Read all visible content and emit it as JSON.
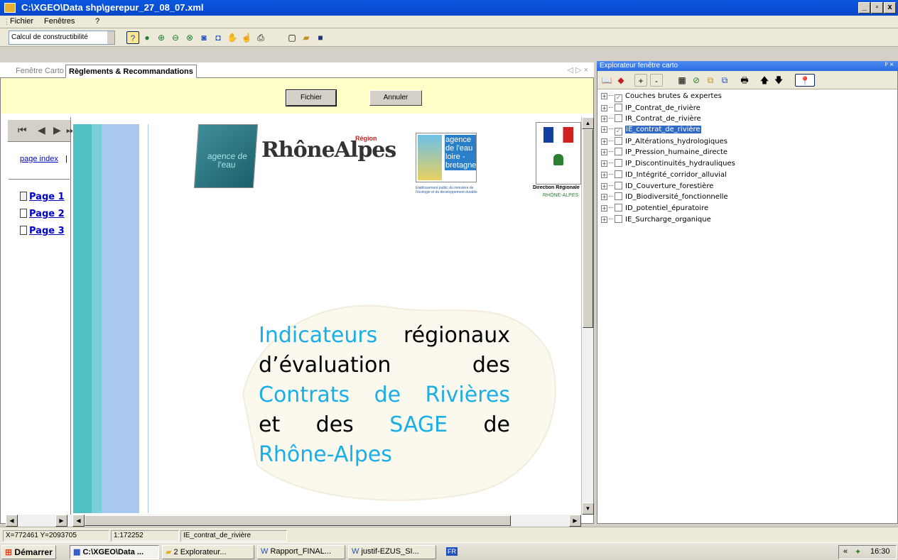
{
  "window": {
    "title": "C:\\XGEO\\Data shp\\gerepur_27_08_07.xml",
    "minimize": "_",
    "maximize": "▫",
    "close": "x"
  },
  "menu": {
    "items": [
      "Fichier",
      "Fenêtres",
      "?"
    ]
  },
  "toolbar": {
    "combo_value": "Calcul de constructibilité"
  },
  "tabs": {
    "inactive": "Fenêtre Carto",
    "active": "Règlements & Recommandations",
    "nav": "◁ ▷ ×"
  },
  "form": {
    "fichier": "Fichier",
    "annuler": "Annuler"
  },
  "index": {
    "page_index": "page index",
    "pages": [
      "Page 1",
      "Page 2",
      "Page 3"
    ]
  },
  "document": {
    "logo_region_small": "Région",
    "logo_region": "RhôneAlpes",
    "logo_agence": "agence de l'eau",
    "logo_loire": [
      "agence",
      "de l'eau",
      "loire -",
      "bretagne"
    ],
    "logo_loire_caption": "Etablissement public du ministère de l'écologie et du développement durable",
    "logo_diren": "Direction Régionale de l'Envir",
    "logo_diren_sub": "RHÔNE-ALPES",
    "heading_lines": [
      [
        {
          "t": "Indicateurs",
          "c": "cyan"
        },
        {
          "t": "régionaux",
          "c": "black"
        }
      ],
      [
        {
          "t": "d’évaluation",
          "c": "black"
        },
        {
          "t": "des",
          "c": "black"
        }
      ],
      [
        {
          "t": "Contrats",
          "c": "cyan"
        },
        {
          "t": "de",
          "c": "cyan"
        },
        {
          "t": "Rivières",
          "c": "cyan"
        }
      ],
      [
        {
          "t": "et",
          "c": "black"
        },
        {
          "t": "des",
          "c": "black"
        },
        {
          "t": "SAGE",
          "c": "cyan"
        },
        {
          "t": "de",
          "c": "black"
        }
      ],
      [
        {
          "t": "Rhône-Alpes",
          "c": "cyan"
        }
      ]
    ]
  },
  "explorer": {
    "title": "Explorateur fenêtre carto",
    "pin": "ᵖ ×",
    "tools": [
      "📖",
      "◆",
      "+",
      "-",
      "▦",
      "⊘",
      "⧉",
      "⧉",
      "🖶",
      "🡅",
      "🡇",
      "📍"
    ],
    "layers": [
      {
        "label": "Couches brutes & expertes",
        "checked": true,
        "selected": false
      },
      {
        "label": "IP_Contrat_de_rivière",
        "checked": false,
        "selected": false
      },
      {
        "label": "IR_Contrat_de_rivière",
        "checked": false,
        "selected": false
      },
      {
        "label": "IE_contrat_de_rivière",
        "checked": true,
        "selected": true
      },
      {
        "label": "IP_Altérations_hydrologiques",
        "checked": false,
        "selected": false
      },
      {
        "label": "IP_Pression_humaine_directe",
        "checked": false,
        "selected": false
      },
      {
        "label": "IP_Discontinuités_hydrauliques",
        "checked": false,
        "selected": false
      },
      {
        "label": "ID_Intégrité_corridor_alluvial",
        "checked": false,
        "selected": false
      },
      {
        "label": "ID_Couverture_forestière",
        "checked": false,
        "selected": false
      },
      {
        "label": "ID_Biodiversité_fonctionnelle",
        "checked": false,
        "selected": false
      },
      {
        "label": "ID_potentiel_épuratoire",
        "checked": false,
        "selected": false
      },
      {
        "label": "IE_Surcharge_organique",
        "checked": false,
        "selected": false
      }
    ]
  },
  "status": {
    "coords": "X=772461 Y=2093705",
    "scale": "1:172252",
    "layer": "IE_contrat_de_rivière"
  },
  "taskbar": {
    "start": "Démarrer",
    "tasks": [
      "C:\\XGEO\\Data ...",
      "2 Explorateur...",
      "Rapport_FINAL...",
      "justif-EZUS_SI..."
    ],
    "lang": "FR",
    "tray_arrows": "«",
    "time": "16:30"
  }
}
